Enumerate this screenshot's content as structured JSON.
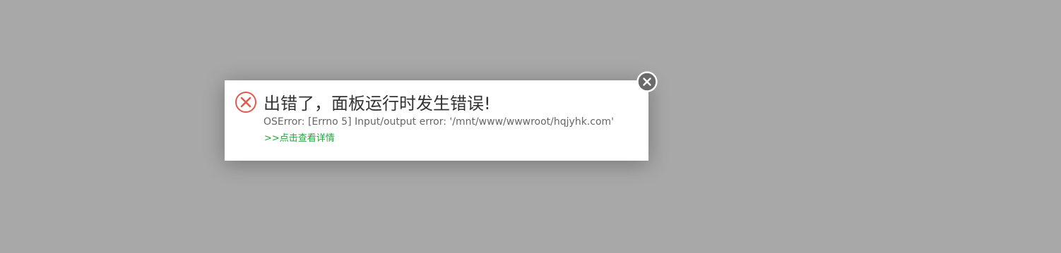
{
  "dialog": {
    "title": "出错了，面板运行时发生错误!",
    "message": "OSError: [Errno 5] Input/output error: '/mnt/www/wwwroot/hqjyhk.com'",
    "details_link": ">>点击查看详情",
    "error_icon": "error-circle-x-icon",
    "close_icon": "close-circle-icon"
  },
  "colors": {
    "overlay": "#a8a8a8",
    "error_icon": "#e05a4f",
    "link": "#20a53a",
    "close_button": "#6a6a6a"
  }
}
